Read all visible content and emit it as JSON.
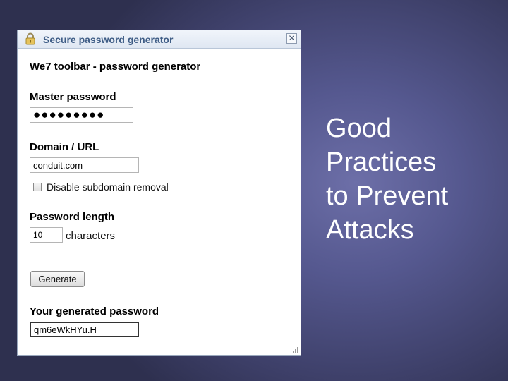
{
  "window": {
    "title": "Secure password generator",
    "close_symbol": "✕",
    "lock_icon": "lock-icon"
  },
  "form": {
    "heading": "We7 toolbar - password generator",
    "master_label": "Master password",
    "master_value": "●●●●●●●●●",
    "domain_label": "Domain / URL",
    "domain_value": "conduit.com",
    "subdomain_checkbox_label": "Disable subdomain removal",
    "subdomain_checked": false,
    "length_label": "Password length",
    "length_value": "10",
    "length_units": "characters",
    "generate_label": "Generate",
    "result_label": "Your generated password",
    "result_value": "qm6eWkHYu.H"
  },
  "slide": {
    "title_lines": [
      "Good",
      "Practices",
      "to Prevent",
      "Attacks"
    ]
  },
  "colors": {
    "background": "#55588f",
    "titlebar_text": "#3f5d86",
    "window_border": "#9aa8bd",
    "slide_text": "#ffffff"
  }
}
